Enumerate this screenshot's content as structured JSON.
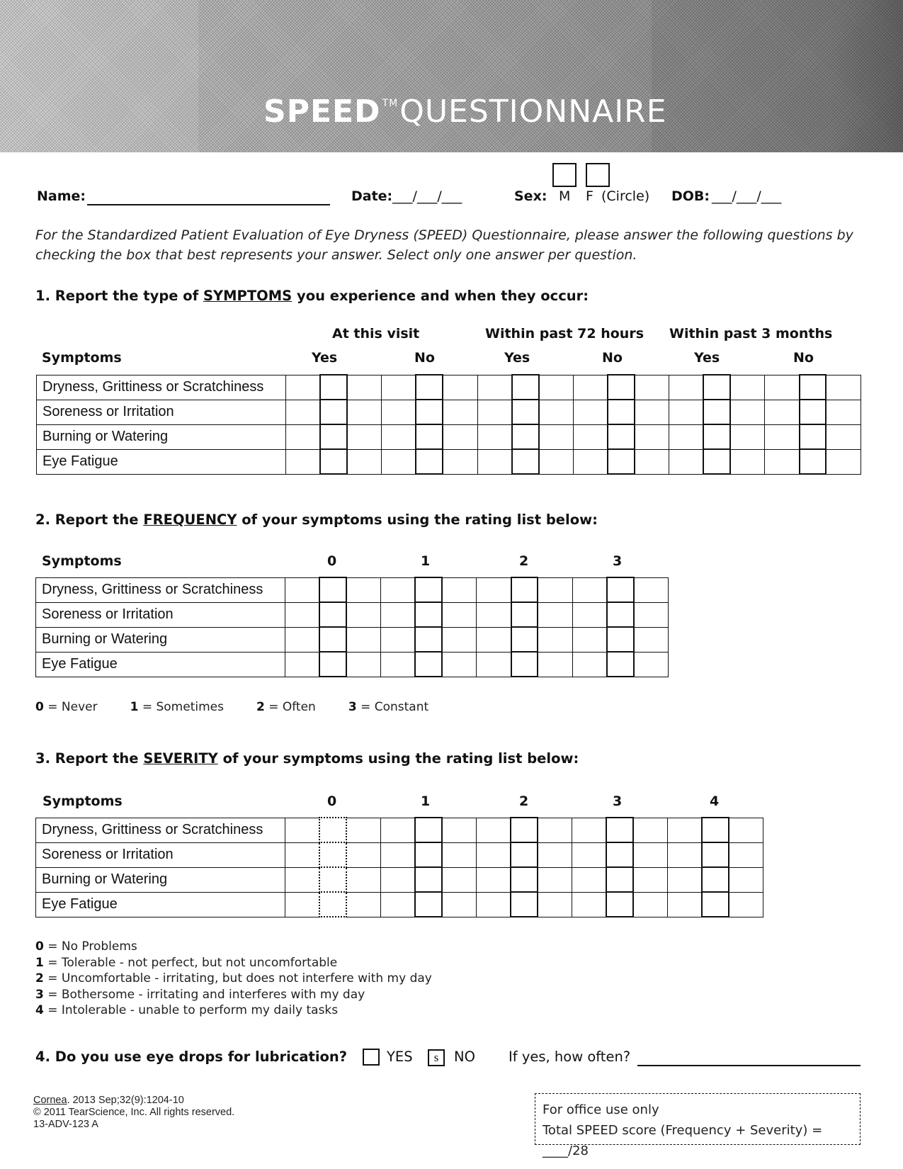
{
  "banner": {
    "title_bold": "SPEED",
    "trademark": "TM",
    "title_light": "QUESTIONNAIRE"
  },
  "header_fields": {
    "name_label": "Name:",
    "name_line": "______________________________",
    "date_label": "Date:",
    "date_line": "___/___/___",
    "sex_label": "Sex:",
    "sex_m": "M",
    "sex_f": "F",
    "sex_note": "(Circle)",
    "dob_label": "DOB:",
    "dob_line": "___/___/___"
  },
  "intro": "For the Standardized Patient Evaluation of Eye Dryness (SPEED) Questionnaire, please answer the following questions by checking the box that best represents your answer. Select only one answer per question.",
  "symptoms": [
    "Dryness, Grittiness or Scratchiness",
    "Soreness or Irritation",
    "Burning or Watering",
    "Eye Fatigue"
  ],
  "q1": {
    "prefix": "1. Report the type of ",
    "keyword": "SYMPTOMS",
    "suffix": " you experience and when they occur:",
    "symptoms_header": "Symptoms",
    "groups": [
      "At this visit",
      "Within past 72 hours",
      "Within past 3 months"
    ],
    "options": [
      "Yes",
      "No",
      "Yes",
      "No",
      "Yes",
      "No"
    ]
  },
  "q2": {
    "prefix": "2. Report the ",
    "keyword": "FREQUENCY",
    "suffix": " of your symptoms using the rating list below:",
    "symptoms_header": "Symptoms",
    "scale": [
      "0",
      "1",
      "2",
      "3"
    ],
    "legend": [
      {
        "key": "0",
        "text": " = Never"
      },
      {
        "key": "1",
        "text": " = Sometimes"
      },
      {
        "key": "2",
        "text": " = Often"
      },
      {
        "key": "3",
        "text": " = Constant"
      }
    ]
  },
  "q3": {
    "prefix": "3. Report the ",
    "keyword": "SEVERITY",
    "suffix": " of your symptoms using the rating list below:",
    "symptoms_header": "Symptoms",
    "scale": [
      "0",
      "1",
      "2",
      "3",
      "4"
    ],
    "legend": [
      {
        "key": "0",
        "text": " = No Problems"
      },
      {
        "key": "1",
        "text": " = Tolerable - not perfect, but not uncomfortable"
      },
      {
        "key": "2",
        "text": " = Uncomfortable - irritating, but does not interfere with my day"
      },
      {
        "key": "3",
        "text": " = Bothersome - irritating and interferes with my day"
      },
      {
        "key": "4",
        "text": " = Intolerable - unable to perform my daily tasks"
      }
    ]
  },
  "q4": {
    "question": "4. Do you use eye drops for lubrication?",
    "yes_label": "YES",
    "no_label": "NO",
    "no_box_mark": "s",
    "followup": "If yes, how often?"
  },
  "footer": {
    "journal": "Cornea",
    "citation": ". 2013 Sep;32(9):1204-10",
    "copyright": "© 2011 TearScience, Inc. All rights reserved.",
    "code": "13-ADV-123 A"
  },
  "office": {
    "title": "For office use only",
    "score_label": "Total SPEED score (Frequency + Severity) = ____/28"
  }
}
